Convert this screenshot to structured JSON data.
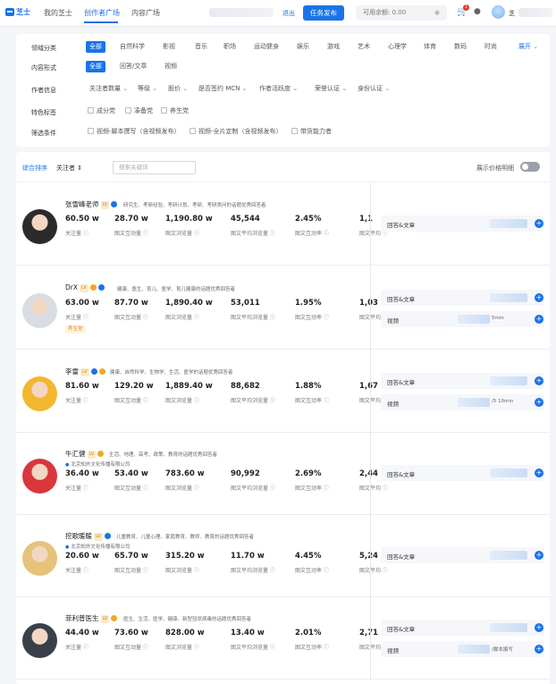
{
  "topbar": {
    "logo": "芝士",
    "nav": [
      "我的芝士",
      "创作者广场",
      "内容广场"
    ],
    "logout": "退出",
    "task_button": "任务发布",
    "balance_label": "可用余额: 0.00",
    "cart_badge": "1",
    "user_name": "芝"
  },
  "filters": {
    "rows": [
      {
        "label": "领域分类",
        "chips": [
          "全部",
          "自然科学",
          "影视",
          "音乐",
          "职场",
          "运动健身",
          "娱乐",
          "游戏",
          "艺术",
          "心理学",
          "体育",
          "数码",
          "时尚"
        ],
        "expand": "展开"
      },
      {
        "label": "内容形式",
        "chips": [
          "全部",
          "回答/文章",
          "视频"
        ]
      },
      {
        "label": "作者信息",
        "dropdowns": [
          "关注者数量",
          "等级",
          "股价",
          "是否签约 MCN",
          "作者活跃度",
          "荣誉认证",
          "身份认证"
        ]
      },
      {
        "label": "特色标签",
        "checks": [
          "成分党",
          "凑备党",
          "养生党"
        ]
      },
      {
        "label": "筛选条件",
        "checks": [
          "视频-脚本撰写（含视频发布）",
          "视频-全片定制（含视频发布）",
          "带货能力者"
        ]
      }
    ]
  },
  "sortbar": {
    "sort_default": "综合排序",
    "sort_followers": "关注者 ⇕",
    "search_placeholder": "搜索关键词",
    "price_toggle": "展示价格明细"
  },
  "stat_labels": [
    "关注量",
    "图文互动量",
    "图文浏览量",
    "图文平均浏览量",
    "图文互动率",
    "图文平均"
  ],
  "creators": [
    {
      "name": "张雪峰老师",
      "lv": "LV",
      "tags": "研究生、考研经验、考研计划、考研、考研类问的话题优秀回答者",
      "stats": [
        "60.50 w",
        "28.70 w",
        "1,190.80 w",
        "45,544",
        "2.45%",
        "1,1"
      ],
      "services": [
        {
          "label": "回答&文章",
          "note": ""
        }
      ],
      "avatar": "#2b2b2b"
    },
    {
      "name": "DrX",
      "lv": "LV",
      "tags": "健康、医生、育儿、医学、育儿健康的话题优秀回答者",
      "stats": [
        "63.00 w",
        "87.70 w",
        "1,890.40 w",
        "53,011",
        "1.95%",
        "1,03"
      ],
      "extra": "养生党",
      "services": [
        {
          "label": "回答&文章",
          "note": ""
        },
        {
          "label": "视频",
          "note": "5min"
        }
      ],
      "avatar": "#d9dce3"
    },
    {
      "name": "李雷",
      "lv": "LV",
      "tags": "健康、自然科学、生物学、生活、医学的话题优秀回答者",
      "stats": [
        "81.60 w",
        "129.20 w",
        "1,889.40 w",
        "88,682",
        "1.88%",
        "1,67"
      ],
      "services": [
        {
          "label": "回答&文章",
          "note": ""
        },
        {
          "label": "视频",
          "note": "/5 10min"
        }
      ],
      "avatar": "#f3b62f"
    },
    {
      "name": "牛汇健",
      "lv": "LV",
      "tags": "生活、地理、高考、政策、教育的话题优秀回答者",
      "org": "北京知外文化传播有限公司",
      "stats": [
        "36.40 w",
        "53.40 w",
        "783.60 w",
        "90,992",
        "2.69%",
        "2,44"
      ],
      "services": [
        {
          "label": "回答&文章",
          "note": ""
        }
      ],
      "avatar": "#d8373c"
    },
    {
      "name": "挖歌暖暖",
      "lv": "LV",
      "tags": "儿童教育、儿童心理、家庭教育、教师、教育的话题优秀回答者",
      "org": "北京知外文化传播有限公司",
      "stats": [
        "20.60 w",
        "65.70 w",
        "315.20 w",
        "11.70 w",
        "4.45%",
        "5,24"
      ],
      "services": [
        {
          "label": "回答&文章",
          "note": ""
        }
      ],
      "avatar": "#e6c27a"
    },
    {
      "name": "菲利普医生",
      "lv": "LV",
      "tags": "医生、生活、医学、健康、新型冠状病毒的话题优秀回答者",
      "stats": [
        "44.40 w",
        "73.60 w",
        "828.00 w",
        "13.40 w",
        "2.01%",
        "2,71"
      ],
      "services": [
        {
          "label": "回答&文章",
          "note": ""
        },
        {
          "label": "视频",
          "note": "/脚本撰写"
        }
      ],
      "avatar": "#3a3f4a"
    }
  ]
}
